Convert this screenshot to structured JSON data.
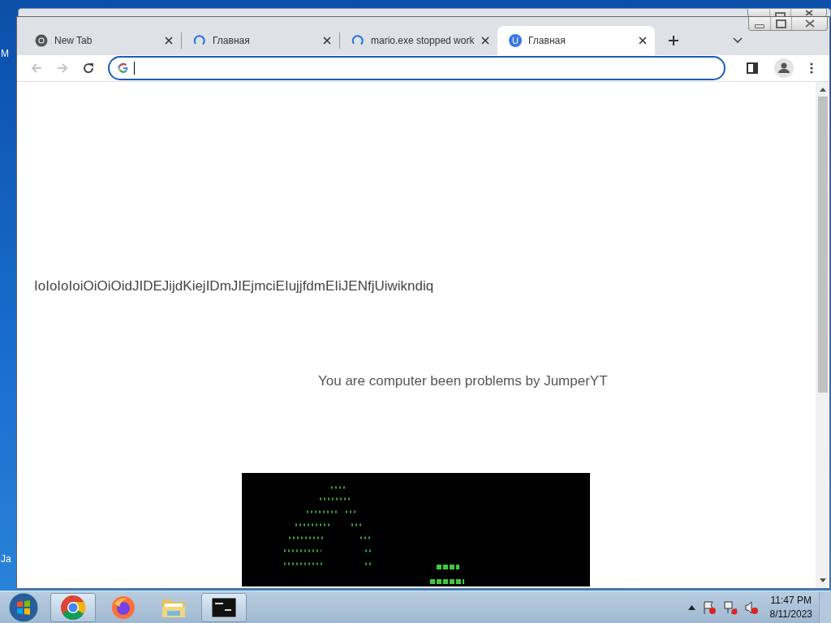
{
  "desktop": {
    "icon_labels": [
      "M",
      "Ja"
    ]
  },
  "browser": {
    "tabs": [
      {
        "title": "New Tab",
        "kind": "chrome",
        "selected": false
      },
      {
        "title": "Главная",
        "kind": "loading",
        "selected": false
      },
      {
        "title": "mario.exe stopped work",
        "kind": "loading",
        "selected": false
      },
      {
        "title": "Главная",
        "kind": "site",
        "icon_letter": "U",
        "selected": true
      }
    ],
    "page": {
      "heading": "IoIoIoIoiOiOiOidJIDEJijdKiejIDmJIEjmciEIujjfdmEIiJENfjUiwikndiq",
      "tagline": "You are computer been problems by JumperYT"
    }
  },
  "taskbar": {
    "apps": [
      {
        "kind": "chrome",
        "running": true
      },
      {
        "kind": "firefox",
        "running": false
      },
      {
        "kind": "explorer",
        "running": false
      },
      {
        "kind": "cmd",
        "running": true
      }
    ],
    "time": "11:47 PM",
    "date": "8/11/2023"
  }
}
